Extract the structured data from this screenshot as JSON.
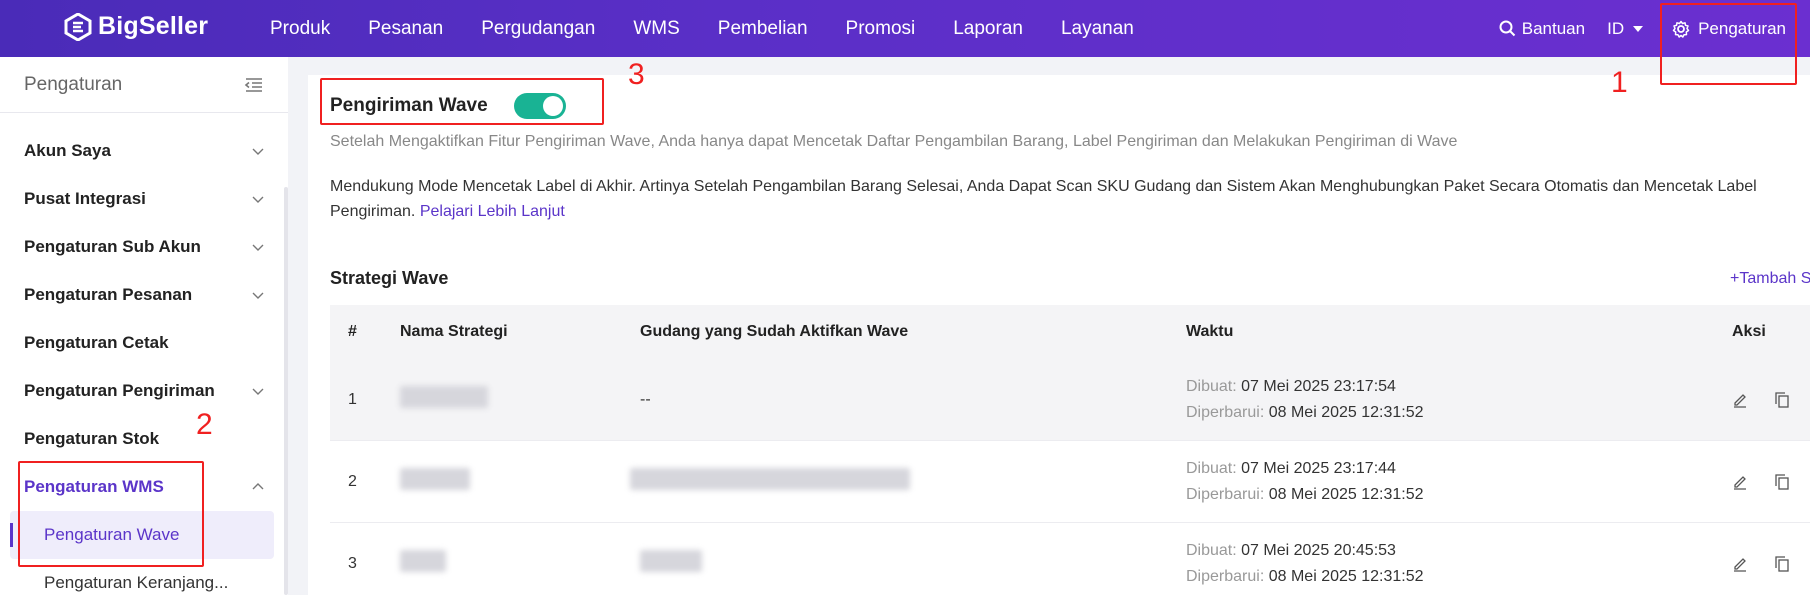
{
  "brand": {
    "name": "BigSeller"
  },
  "nav": {
    "items": [
      "Produk",
      "Pesanan",
      "Pergudangan",
      "WMS",
      "Pembelian",
      "Promosi",
      "Laporan",
      "Layanan"
    ],
    "help_label": "Bantuan",
    "lang_label": "ID",
    "settings_label": "Pengaturan"
  },
  "sidebar": {
    "title": "Pengaturan",
    "items": [
      {
        "label": "Akun Saya"
      },
      {
        "label": "Pusat Integrasi"
      },
      {
        "label": "Pengaturan Sub Akun"
      },
      {
        "label": "Pengaturan Pesanan"
      },
      {
        "label": "Pengaturan Cetak"
      },
      {
        "label": "Pengaturan Pengiriman"
      },
      {
        "label": "Pengaturan Stok"
      },
      {
        "label": "Pengaturan WMS"
      }
    ],
    "sub_items": [
      "Pengaturan Wave",
      "Pengaturan Keranjang..."
    ]
  },
  "main": {
    "wave_title": "Pengiriman Wave",
    "wave_enabled": true,
    "desc1": "Setelah Mengaktifkan Fitur Pengiriman Wave, Anda hanya dapat Mencetak Daftar Pengambilan Barang, Label Pengiriman dan Melakukan Pengiriman di Wave",
    "desc2": "Mendukung Mode Mencetak Label di Akhir. Artinya Setelah Pengambilan Barang Selesai, Anda Dapat Scan SKU Gudang dan Sistem Akan Menghubungkan Paket Secara Otomatis dan Mencetak Label",
    "desc2_end": "Pengiriman.",
    "learn_more": "Pelajari Lebih Lanjut",
    "strategy_title": "Strategi Wave",
    "add_label": "+Tambah S",
    "table": {
      "headers": [
        "#",
        "Nama Strategi",
        "Gudang yang Sudah Aktifkan Wave",
        "Waktu",
        "Aksi"
      ],
      "created_label": "Dibuat:",
      "updated_label": "Diperbarui:",
      "rows": [
        {
          "num": "1",
          "warehouse": "--",
          "created": "07 Mei 2025 23:17:54",
          "updated": "08 Mei 2025 12:31:52"
        },
        {
          "num": "2",
          "warehouse": "",
          "created": "07 Mei 2025 23:17:44",
          "updated": "08 Mei 2025 12:31:52"
        },
        {
          "num": "3",
          "warehouse": "",
          "created": "07 Mei 2025 20:45:53",
          "updated": "08 Mei 2025 12:31:52"
        }
      ]
    }
  },
  "annotations": [
    "1",
    "2",
    "3"
  ],
  "colors": {
    "accent": "#5b35c9",
    "toggle_on": "#19b394",
    "annotation": "#f02020"
  }
}
